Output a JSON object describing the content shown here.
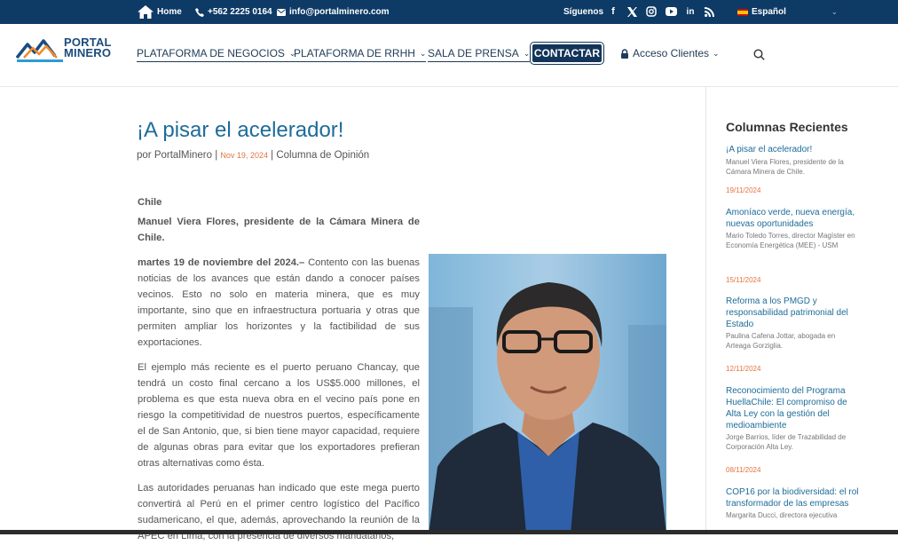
{
  "topbar": {
    "home_label": "Home",
    "phone": "+562 2225 0164",
    "email": "info@portalminero.com",
    "follow_label": "Síguenos",
    "language": "Español",
    "social_icons": [
      "facebook-icon",
      "x-icon",
      "instagram-icon",
      "youtube-icon",
      "linkedin-icon",
      "rss-icon"
    ]
  },
  "logo": {
    "line1": "PORTAL",
    "line2": "MINERO"
  },
  "nav": {
    "items": [
      {
        "label": "PLATAFORMA DE NEGOCIOS"
      },
      {
        "label": "PLATAFORMA DE RRHH"
      },
      {
        "label": "SALA DE PRENSA"
      }
    ],
    "contact_label": "CONTACTAR",
    "clients_label": "Acceso Clientes"
  },
  "article": {
    "title": "¡A pisar el acelerador!",
    "by": "por",
    "author": "PortalMinero",
    "date": "Nov 19, 2024",
    "category": "Columna de Opinión",
    "location": "Chile",
    "byline": "Manuel Viera Flores, presidente de la Cámara Minera de Chile.",
    "lead_date": "martes 19 de noviembre del 2024.–",
    "p1": " Contento con las buenas noticias de los avances que están dando a conocer países vecinos. Esto no solo en materia minera, que es muy importante, sino que en infraestructura portuaria y otras que permiten ampliar los horizontes y la factibilidad de sus exportaciones.",
    "p2": "El ejemplo más reciente es el puerto peruano Chancay, que tendrá un costo final cercano a los US$5.000 millones, el problema es que esta nueva obra en el vecino país pone en riesgo la competitividad de nuestros puertos, específicamente el de San Antonio, que, si bien tiene mayor capacidad, requiere de algunas obras para evitar que los exportadores prefieran otras alternativas como ésta.",
    "p3": "Las autoridades peruanas han indicado que este mega puerto convertirá al Perú en el primer centro logístico del Pacífico sudamericano, el que, además, aprovechando la reunión de la APEC en Lima, con la presencia de diversos mandatarios,"
  },
  "sidebar": {
    "title": "Columnas Recientes",
    "entries": [
      {
        "title": "¡A pisar el acelerador!",
        "desc": "Manuel Viera Flores, presidente de la Cámara Minera de Chile.",
        "date": "19/11/2024"
      },
      {
        "title": "Amoníaco verde, nueva energía, nuevas oportunidades",
        "desc": "Mario Toledo Torres, director Magíster en Economía Energética (MEE) - USM",
        "date": "15/11/2024"
      },
      {
        "title": "Reforma a los PMGD y responsabilidad patrimonial del Estado",
        "desc": "Paulina Cafena Jottar, abogada en Arteaga Gorziglia.",
        "date": "12/11/2024"
      },
      {
        "title": "Reconocimiento del Programa HuellaChile: El compromiso de Alta Ley con la gestión del medioambiente",
        "desc": "Jorge Barrios, líder de Trazabilidad de Corporación Alta Ley.",
        "date": "08/11/2024"
      },
      {
        "title": "COP16 por la biodiversidad: el rol transformador de las empresas",
        "desc": "Margarita Ducci, directora ejecutiva"
      }
    ]
  }
}
